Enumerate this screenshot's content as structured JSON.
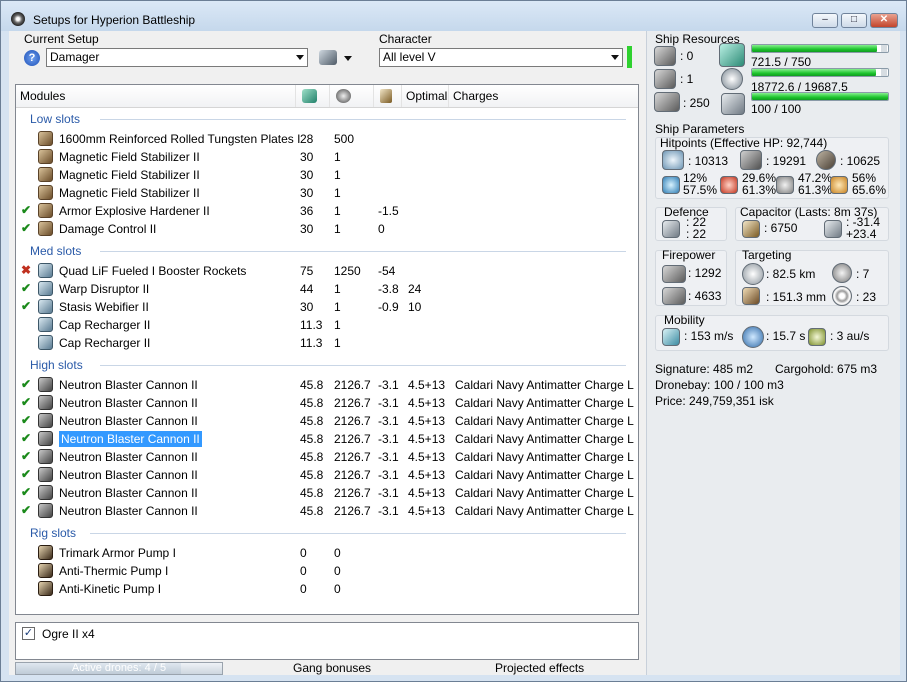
{
  "window": {
    "title": "Setups for Hyperion Battleship",
    "minimize": "–",
    "maximize": "□",
    "close": "✕"
  },
  "setup": {
    "label": "Current Setup",
    "value": "Damager",
    "help_icon": "?"
  },
  "character": {
    "label": "Character",
    "value": "All level V",
    "status_color": "#2fd12f"
  },
  "columns": {
    "modules": "Modules",
    "optimal": "Optimal",
    "charges": "Charges"
  },
  "sections": {
    "low": "Low slots",
    "med": "Med slots",
    "high": "High slots",
    "rig": "Rig slots"
  },
  "low_slots": [
    {
      "check": "",
      "name": "1600mm Reinforced Rolled Tungsten Plates I",
      "cpu": "28",
      "pg": "500",
      "cap": "",
      "optimal": "",
      "charge": ""
    },
    {
      "check": "",
      "name": "Magnetic Field Stabilizer II",
      "cpu": "30",
      "pg": "1",
      "cap": "",
      "optimal": "",
      "charge": ""
    },
    {
      "check": "",
      "name": "Magnetic Field Stabilizer II",
      "cpu": "30",
      "pg": "1",
      "cap": "",
      "optimal": "",
      "charge": ""
    },
    {
      "check": "",
      "name": "Magnetic Field Stabilizer II",
      "cpu": "30",
      "pg": "1",
      "cap": "",
      "optimal": "",
      "charge": ""
    },
    {
      "check": "✔",
      "name": "Armor Explosive Hardener II",
      "cpu": "36",
      "pg": "1",
      "cap": "-1.5",
      "optimal": "",
      "charge": ""
    },
    {
      "check": "✔",
      "name": "Damage Control II",
      "cpu": "30",
      "pg": "1",
      "cap": "0",
      "optimal": "",
      "charge": ""
    }
  ],
  "med_slots": [
    {
      "check": "✖",
      "name": "Quad LiF Fueled I Booster Rockets",
      "cpu": "75",
      "pg": "1250",
      "cap": "-54",
      "optimal": "",
      "charge": ""
    },
    {
      "check": "✔",
      "name": "Warp Disruptor II",
      "cpu": "44",
      "pg": "1",
      "cap": "-3.8",
      "optimal": "24",
      "charge": ""
    },
    {
      "check": "✔",
      "name": "Stasis Webifier II",
      "cpu": "30",
      "pg": "1",
      "cap": "-0.9",
      "optimal": "10",
      "charge": ""
    },
    {
      "check": "",
      "name": "Cap Recharger II",
      "cpu": "11.3",
      "pg": "1",
      "cap": "",
      "optimal": "",
      "charge": ""
    },
    {
      "check": "",
      "name": "Cap Recharger II",
      "cpu": "11.3",
      "pg": "1",
      "cap": "",
      "optimal": "",
      "charge": ""
    }
  ],
  "high_slots": [
    {
      "check": "✔",
      "name": "Neutron Blaster Cannon II",
      "cpu": "45.8",
      "pg": "2126.7",
      "cap": "-3.1",
      "optimal": "4.5+13",
      "charge": "Caldari Navy Antimatter Charge L"
    },
    {
      "check": "✔",
      "name": "Neutron Blaster Cannon II",
      "cpu": "45.8",
      "pg": "2126.7",
      "cap": "-3.1",
      "optimal": "4.5+13",
      "charge": "Caldari Navy Antimatter Charge L"
    },
    {
      "check": "✔",
      "name": "Neutron Blaster Cannon II",
      "cpu": "45.8",
      "pg": "2126.7",
      "cap": "-3.1",
      "optimal": "4.5+13",
      "charge": "Caldari Navy Antimatter Charge L"
    },
    {
      "check": "✔",
      "name": "Neutron Blaster Cannon II",
      "cpu": "45.8",
      "pg": "2126.7",
      "cap": "-3.1",
      "optimal": "4.5+13",
      "charge": "Caldari Navy Antimatter Charge L"
    },
    {
      "check": "✔",
      "name": "Neutron Blaster Cannon II",
      "cpu": "45.8",
      "pg": "2126.7",
      "cap": "-3.1",
      "optimal": "4.5+13",
      "charge": "Caldari Navy Antimatter Charge L"
    },
    {
      "check": "✔",
      "name": "Neutron Blaster Cannon II",
      "cpu": "45.8",
      "pg": "2126.7",
      "cap": "-3.1",
      "optimal": "4.5+13",
      "charge": "Caldari Navy Antimatter Charge L"
    },
    {
      "check": "✔",
      "name": "Neutron Blaster Cannon II",
      "cpu": "45.8",
      "pg": "2126.7",
      "cap": "-3.1",
      "optimal": "4.5+13",
      "charge": "Caldari Navy Antimatter Charge L"
    },
    {
      "check": "✔",
      "name": "Neutron Blaster Cannon II",
      "cpu": "45.8",
      "pg": "2126.7",
      "cap": "-3.1",
      "optimal": "4.5+13",
      "charge": "Caldari Navy Antimatter Charge L"
    }
  ],
  "rig_slots": [
    {
      "check": "",
      "name": "Trimark Armor Pump I",
      "cpu": "0",
      "pg": "0",
      "cap": "",
      "optimal": "",
      "charge": ""
    },
    {
      "check": "",
      "name": "Anti-Thermic Pump I",
      "cpu": "0",
      "pg": "0",
      "cap": "",
      "optimal": "",
      "charge": ""
    },
    {
      "check": "",
      "name": "Anti-Kinetic Pump I",
      "cpu": "0",
      "pg": "0",
      "cap": "",
      "optimal": "",
      "charge": ""
    }
  ],
  "drones": {
    "checked": "✓",
    "label": "Ogre II x4",
    "active": "Active drones: 4 / 5",
    "active_fraction": 0.8,
    "gang": "Gang bonuses",
    "projected": "Projected effects"
  },
  "resources": {
    "title": "Ship Resources",
    "turret_hardpoints": ": 0",
    "launcher_hardpoints": ": 1",
    "calibration": ": 250",
    "cpu": "721.5 / 750",
    "cpu_fraction": 0.962,
    "powergrid": "18772.6 / 19687.5",
    "powergrid_fraction": 0.954,
    "drone_bandwidth": "100 / 100",
    "drone_fraction": 1.0
  },
  "parameters": {
    "title": "Ship Parameters",
    "hitpoints_title": "Hitpoints (Effective HP: 92,744)",
    "shield_hp": ": 10313",
    "armor_hp": ": 19291",
    "hull_hp": ": 10625",
    "em_res": [
      "12%",
      "57.5%"
    ],
    "thermal_res": [
      "29.6%",
      "61.3%"
    ],
    "kinetic_res": [
      "47.2%",
      "61.3%"
    ],
    "explosive_res": [
      "56%",
      "65.6%"
    ],
    "defence_title": "Defence",
    "defence_values": [
      ": 22",
      ": 22"
    ],
    "capacitor_title": "Capacitor (Lasts: 8m 37s)",
    "capacitor_capacity": ": 6750",
    "capacitor_delta": [
      ": -31.4",
      "+23.4"
    ],
    "firepower_title": "Firepower",
    "dps": ": 1292",
    "volley": ": 4633",
    "targeting_title": "Targeting",
    "range": ": 82.5 km",
    "max_targets": ": 7",
    "resolution": ": 151.3 mm",
    "scan": ": 23",
    "mobility_title": "Mobility",
    "speed": ": 153 m/s",
    "align": ": 15.7 s",
    "warp": ": 3 au/s",
    "signature": "Signature: 485 m2",
    "cargohold": "Cargohold: 675 m3",
    "dronebay": "Dronebay: 100 / 100 m3",
    "price": "Price: 249,759,351 isk"
  }
}
